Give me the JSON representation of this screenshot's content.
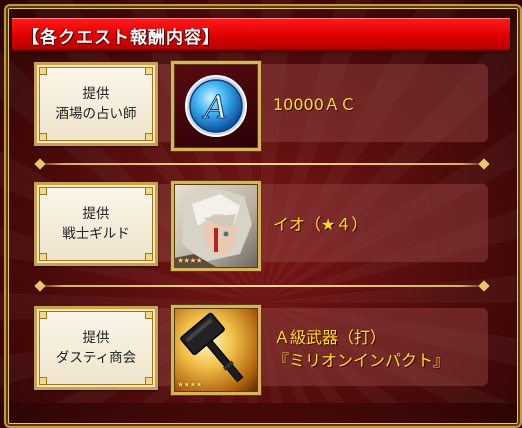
{
  "header": {
    "title": "【各クエスト報酬内容】"
  },
  "rows": [
    {
      "provider_line1": "提供",
      "provider_line2": "酒場の占い師",
      "reward_line1": "10000ＡＣ",
      "icon": "ac-coin-icon"
    },
    {
      "provider_line1": "提供",
      "provider_line2": "戦士ギルド",
      "reward_line1": "イオ（★４）",
      "icon": "character-portrait-icon",
      "stars": "★★★★"
    },
    {
      "provider_line1": "提供",
      "provider_line2": "ダスティ商会",
      "reward_line1": "Ａ級武器（打）",
      "reward_line2": "『ミリオンインパクト』",
      "icon": "hammer-weapon-icon",
      "stars": "★★★★"
    }
  ],
  "colors": {
    "header_red": "#e00000",
    "reward_yellow": "#ffe21f",
    "gold_frame": "#d8b35a"
  }
}
